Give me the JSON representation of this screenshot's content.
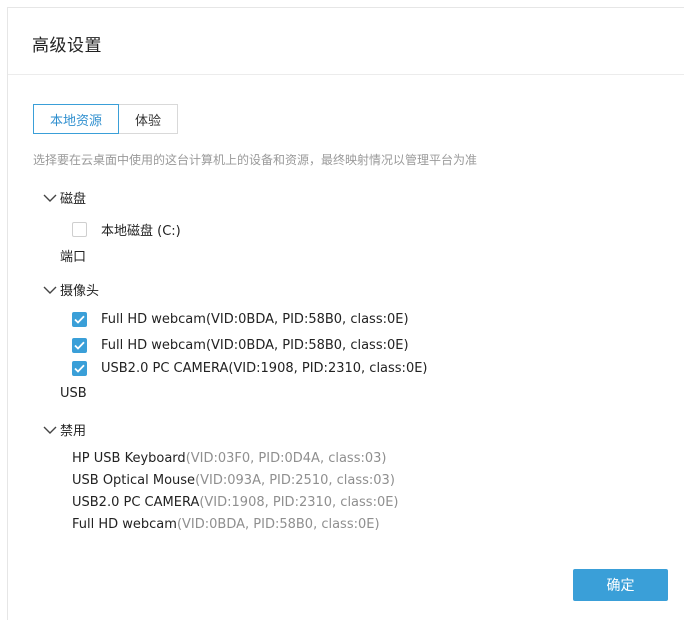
{
  "dialog": {
    "title": "高级设置",
    "tabs": [
      {
        "label": "本地资源",
        "active": true
      },
      {
        "label": "体验",
        "active": false
      }
    ],
    "description": "选择要在云桌面中使用的这台计算机上的设备和资源，最终映射情况以管理平台为准",
    "sections": {
      "disk": {
        "label": "磁盘",
        "items": [
          {
            "label": "本地磁盘 (C:)",
            "checked": false
          }
        ]
      },
      "port": {
        "label": "端口"
      },
      "camera": {
        "label": "摄像头",
        "items": [
          {
            "label": "Full HD webcam(VID:0BDA, PID:58B0, class:0E)",
            "checked": true
          },
          {
            "label": "Full HD webcam(VID:0BDA, PID:58B0, class:0E)",
            "checked": true
          },
          {
            "label": "USB2.0 PC CAMERA(VID:1908, PID:2310, class:0E)",
            "checked": true
          }
        ]
      },
      "usb": {
        "label": "USB"
      },
      "disabled": {
        "label": "禁用",
        "items": [
          {
            "name": "HP USB Keyboard",
            "meta": "(VID:03F0, PID:0D4A, class:03)"
          },
          {
            "name": "USB Optical Mouse",
            "meta": "(VID:093A, PID:2510, class:03)"
          },
          {
            "name": "USB2.0 PC CAMERA",
            "meta": "(VID:1908, PID:2310, class:0E)"
          },
          {
            "name": "Full HD webcam",
            "meta": "(VID:0BDA, PID:58B0, class:0E)"
          }
        ]
      }
    },
    "confirm_label": "确定"
  },
  "colors": {
    "accent": "#3a9fd8",
    "muted_text": "#9a9a9a",
    "checkbox_border": "#cfcfcf"
  },
  "icons": {
    "expand": "chevron-down-icon",
    "check": "check-icon"
  }
}
